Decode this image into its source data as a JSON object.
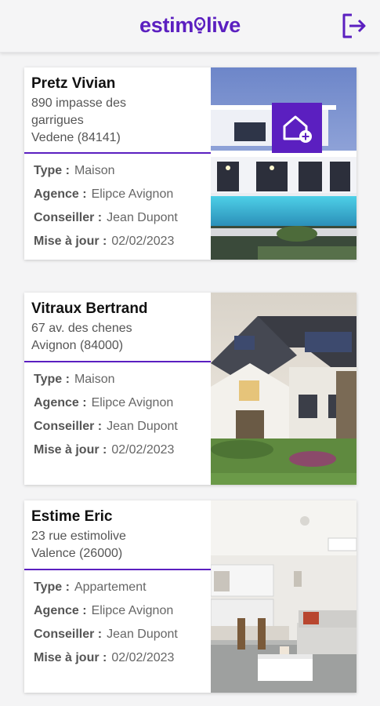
{
  "header": {
    "logo_left": "estim",
    "logo_right": "live",
    "accent_color": "#5b1fc0"
  },
  "labels": {
    "type": "Type :",
    "agence": "Agence :",
    "conseiller": "Conseiller :",
    "mise_a_jour": "Mise à jour :"
  },
  "cards": [
    {
      "name": "Pretz Vivian",
      "address": "890 impasse des\ngarrigues\nVedene (84141)",
      "type": "Maison",
      "agence": "Elipce Avignon",
      "conseiller": "Jean Dupont",
      "mise_a_jour": "02/02/2023"
    },
    {
      "name": "Vitraux Bertrand",
      "address": "67 av. des chenes\nAvignon (84000)",
      "type": "Maison",
      "agence": "Elipce Avignon",
      "conseiller": "Jean Dupont",
      "mise_a_jour": "02/02/2023"
    },
    {
      "name": "Estime Eric",
      "address": "23 rue estimolive\nValence (26000)",
      "type": "Appartement",
      "agence": "Elipce Avignon",
      "conseiller": "Jean Dupont",
      "mise_a_jour": "02/02/2023"
    }
  ],
  "icons": {
    "logout": "logout-icon",
    "add_home": "add-home-icon",
    "logo_bulb": "lightbulb-icon"
  }
}
